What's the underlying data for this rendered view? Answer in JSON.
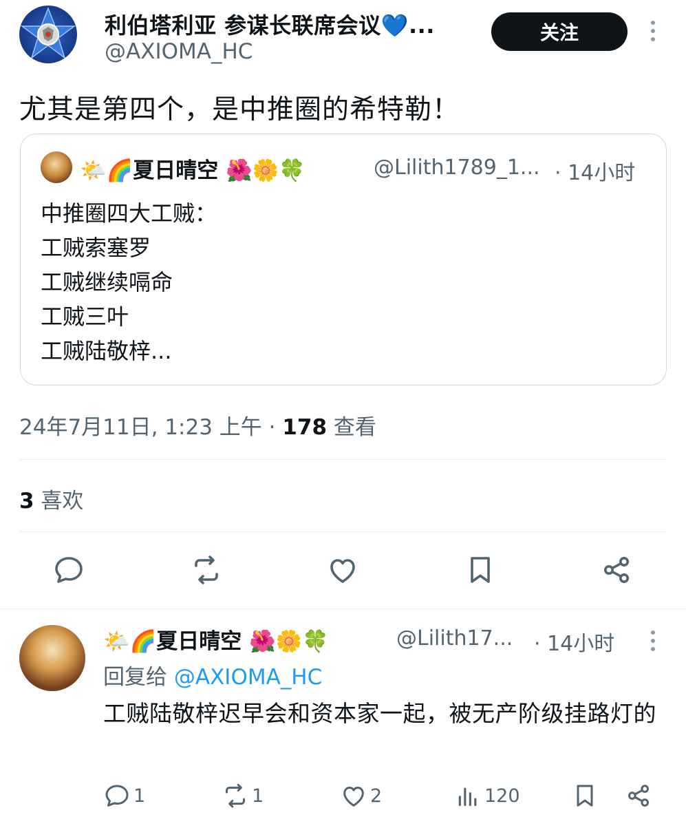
{
  "tweet": {
    "author_name": "利伯塔利亚 参谋长联席会议💙...",
    "author_handle": "@AXIOMA_HC",
    "follow_label": "关注",
    "text": "尤其是第四个，是中推圈的希特勒！",
    "quote": {
      "name": "🌤️🌈夏日晴空 🌺🌼🍀",
      "handle": "@Lilith1789_1...",
      "time": "· 14小时",
      "lines": [
        "中推圈四大工贼：",
        "工贼索塞罗",
        "工贼继续嗝命",
        "工贼三叶",
        "工贼陆敬梓..."
      ]
    },
    "meta": {
      "datetime": "24年7月11日, 1:23 上午 · ",
      "views_count": "178",
      "views_label": " 查看"
    },
    "likes": {
      "count": "3",
      "label": " 喜欢"
    }
  },
  "reply": {
    "name": "🌤️🌈夏日晴空 🌺🌼🍀",
    "handle": "@Lilith17...",
    "time": "· 14小时",
    "replying_prefix": "回复给 ",
    "replying_to": "@AXIOMA_HC",
    "text": "工贼陆敬梓迟早会和资本家一起，被无产阶级挂路灯的",
    "actions": {
      "replies": "1",
      "reposts": "1",
      "likes": "2",
      "views": "120"
    }
  },
  "colors": {
    "accent": "#1d9bf0",
    "text": "#0f1419",
    "muted": "#536471",
    "border": "#cfd9de"
  }
}
